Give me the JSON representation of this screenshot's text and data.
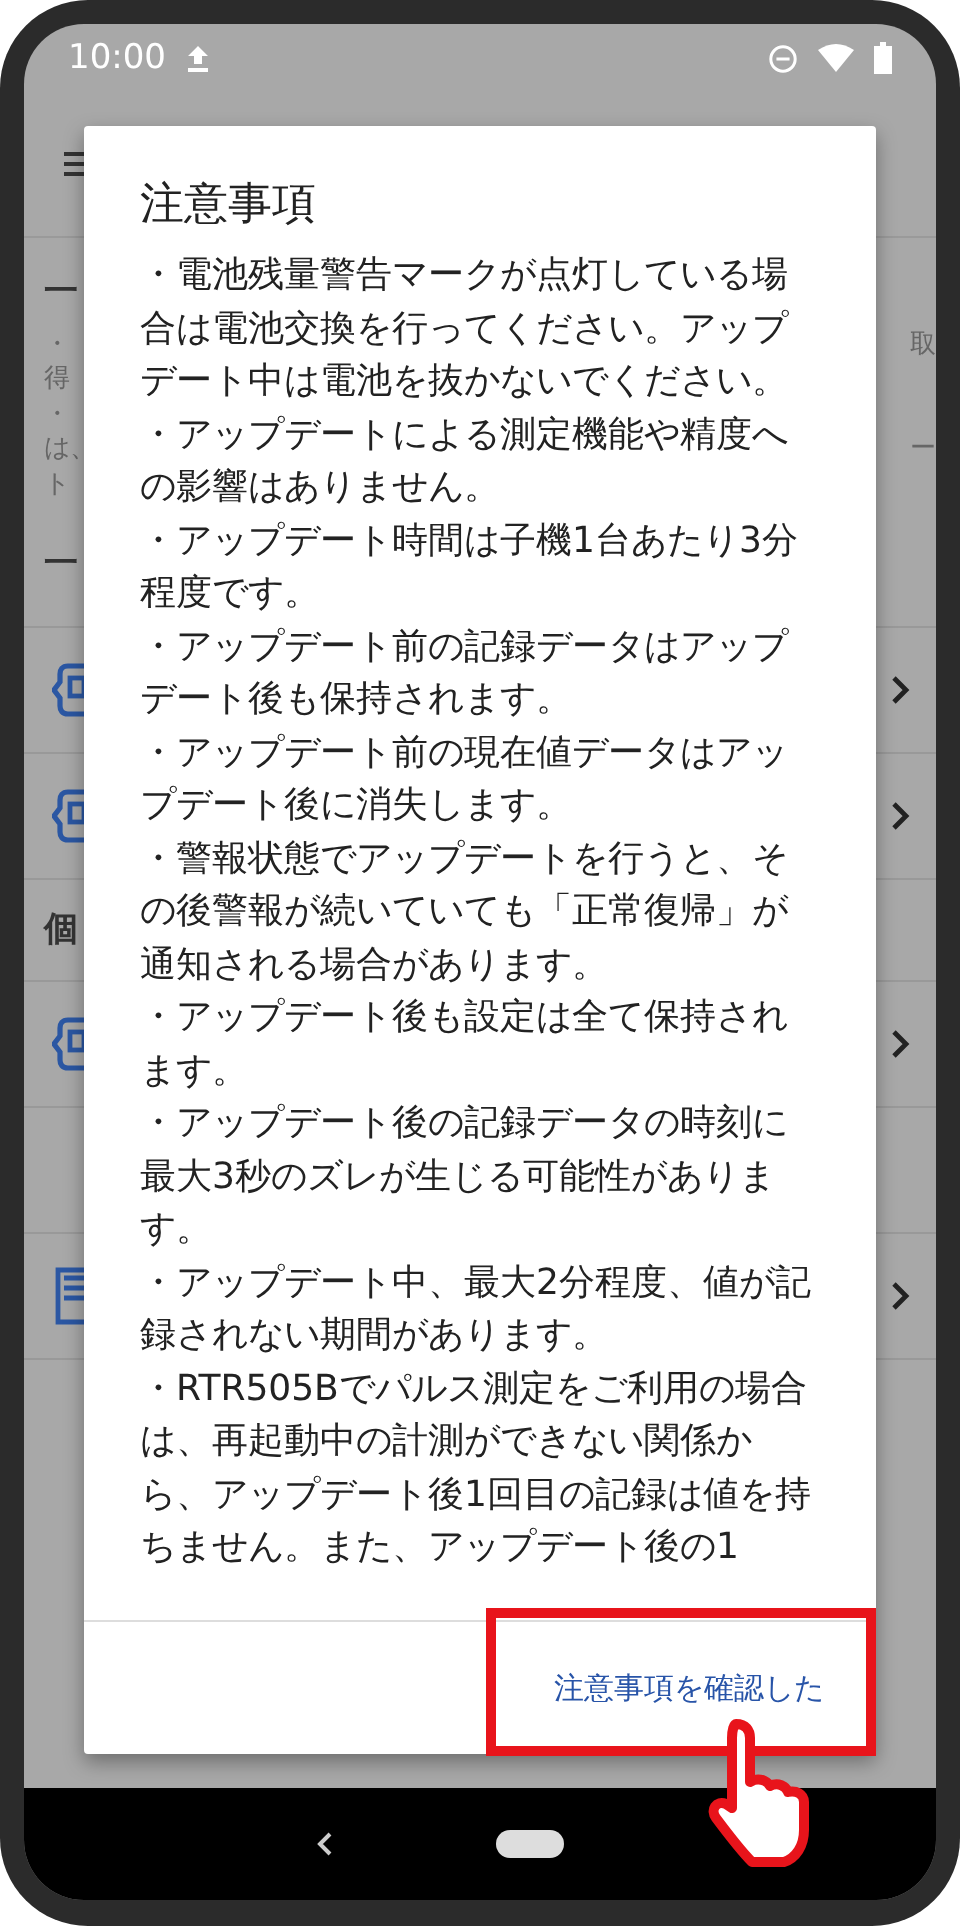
{
  "status_bar": {
    "time": "10:00"
  },
  "background": {
    "heading_1": "一",
    "notes": [
      {
        "left": "・",
        "right": "取"
      },
      {
        "left": "得"
      },
      {
        "left": "・"
      },
      {
        "left": "は、",
        "right": "ー"
      },
      {
        "left": "ト"
      }
    ],
    "heading_2": "一",
    "rows_1": [
      {
        "kind": "device"
      },
      {
        "kind": "device"
      }
    ],
    "heading_3": "個",
    "rows_2": [
      {
        "kind": "device"
      },
      {
        "kind": "blank"
      },
      {
        "kind": "document"
      }
    ]
  },
  "dialog": {
    "title": "注意事項",
    "paragraphs": [
      "・電池残量警告マークが点灯している場合は電池交換を行ってください。アップデート中は電池を抜かないでください。",
      "・アップデートによる測定機能や精度への影響はありません。",
      "・アップデート時間は子機1台あたり3分程度です。",
      "・アップデート前の記録データはアップデート後も保持されます。",
      "・アップデート前の現在値データはアップデート後に消失します。",
      "・警報状態でアップデートを行うと、その後警報が続いていても「正常復帰」が通知される場合があります。",
      "・アップデート後も設定は全て保持されます。",
      "・アップデート後の記録データの時刻に最大3秒のズレが生じる可能性があります。",
      "・アップデート中、最大2分程度、値が記録されない期間があります。",
      " ・RTR505Bでパルス測定をご利用の場合は、再起動中の計測ができない関係から、アップデート後1回目の記録は値を持ちません。また、アップデート後の1"
    ],
    "confirm_button": "注意事項を確認した"
  }
}
